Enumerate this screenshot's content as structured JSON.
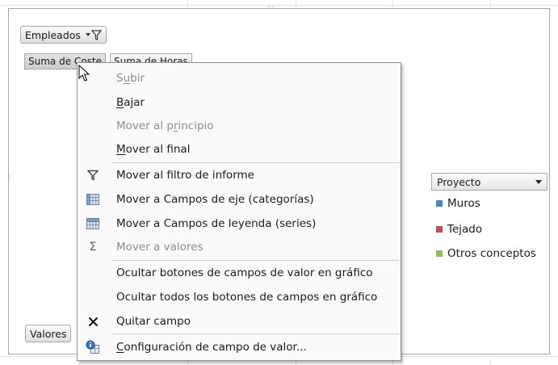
{
  "chart": {
    "filter_button": "Empleados",
    "value_buttons": [
      "Suma de Coste",
      "Suma de Horas"
    ],
    "values_button": "Valores",
    "legend": {
      "title": "Proyecto",
      "items": [
        {
          "label": "Muros",
          "color": "#4f81bd"
        },
        {
          "label": "Tejado",
          "color": "#c0504d"
        },
        {
          "label": "Otros conceptos",
          "color": "#9bbb59"
        }
      ]
    }
  },
  "menu": {
    "items": [
      {
        "pre": "S",
        "key": "u",
        "post": "bir",
        "disabled": true,
        "icon": ""
      },
      {
        "pre": "",
        "key": "B",
        "post": "ajar",
        "disabled": false,
        "icon": ""
      },
      {
        "pre": "Mover al p",
        "key": "r",
        "post": "incipio",
        "disabled": true,
        "icon": ""
      },
      {
        "pre": "",
        "key": "M",
        "post": "over al final",
        "disabled": false,
        "icon": ""
      },
      {
        "pre": "Mover al filtro de informe",
        "key": "",
        "post": "",
        "disabled": false,
        "icon": "filter-icon"
      },
      {
        "pre": "Mover a Campos de eje (categorías)",
        "key": "",
        "post": "",
        "disabled": false,
        "icon": "axis-fields-icon"
      },
      {
        "pre": "Mover a Campos de leyenda (series)",
        "key": "",
        "post": "",
        "disabled": false,
        "icon": "legend-fields-icon"
      },
      {
        "pre": "Mover a valores",
        "key": "",
        "post": "",
        "disabled": true,
        "icon": "sigma-icon"
      },
      {
        "pre": "Ocultar botones de campos de valor en gráfico",
        "key": "",
        "post": "",
        "disabled": false,
        "icon": ""
      },
      {
        "pre": "Ocultar todos los botones de campos en gráfico",
        "key": "",
        "post": "",
        "disabled": false,
        "icon": ""
      },
      {
        "pre": "Quitar campo",
        "key": "",
        "post": "",
        "disabled": false,
        "icon": "remove-icon"
      },
      {
        "pre": "",
        "key": "C",
        "post": "onfiguración de campo de valor...",
        "disabled": false,
        "icon": "field-settings-icon"
      }
    ]
  }
}
